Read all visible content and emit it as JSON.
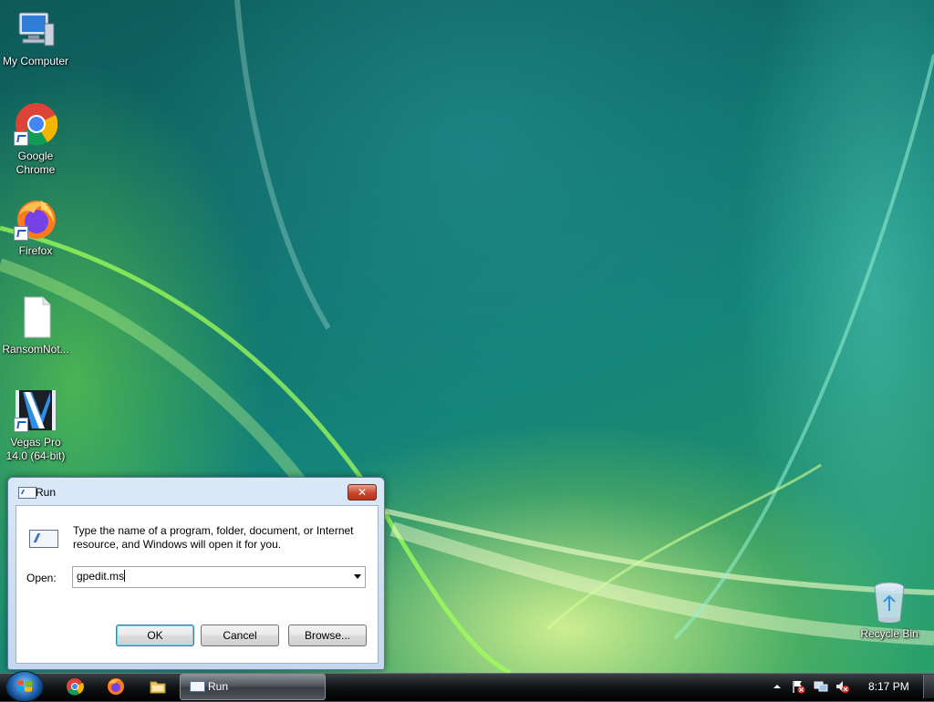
{
  "desktop": {
    "icons": [
      {
        "label": "My Computer"
      },
      {
        "label": "Google\nChrome"
      },
      {
        "label": "Firefox"
      },
      {
        "label": "RansomNot..."
      },
      {
        "label": "Vegas Pro\n14.0 (64-bit)"
      },
      {
        "label": "Recycle Bin"
      }
    ]
  },
  "run_dialog": {
    "title": "Run",
    "close_glyph": "✕",
    "description": "Type the name of a program, folder, document, or Internet resource, and Windows will open it for you.",
    "open_label": "Open:",
    "open_value": "gpedit.ms",
    "buttons": {
      "ok": "OK",
      "cancel": "Cancel",
      "browse": "Browse..."
    }
  },
  "taskbar": {
    "active_task": "Run",
    "clock": "8:17 PM"
  }
}
